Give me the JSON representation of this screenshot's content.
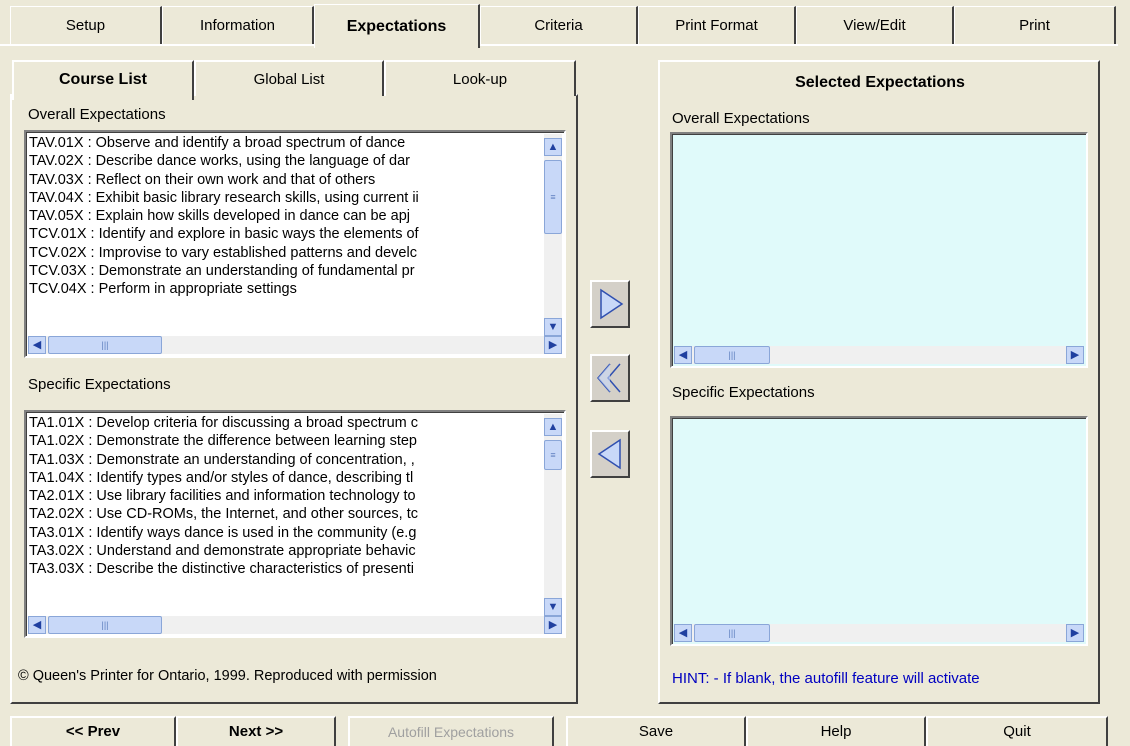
{
  "top_tabs": [
    "Setup",
    "Information",
    "Expectations",
    "Criteria",
    "Print Format",
    "View/Edit",
    "Print"
  ],
  "active_top_tab": "Expectations",
  "left_panel": {
    "tabs": [
      "Course List",
      "Global List",
      "Look-up"
    ],
    "active_tab": "Course List",
    "overall_label": "Overall Expectations",
    "overall_items": [
      "TAV.01X : Observe and identify a broad spectrum of dance",
      "TAV.02X : Describe dance works, using the language of dar",
      "TAV.03X : Reflect on their own work and that of others",
      "TAV.04X : Exhibit basic library research skills, using current ii",
      "TAV.05X : Explain how skills developed in dance can be apj",
      "TCV.01X : Identify and explore in basic ways the elements of",
      "TCV.02X : Improvise to vary established patterns and develc",
      "TCV.03X : Demonstrate an understanding of fundamental pr",
      "TCV.04X : Perform in appropriate settings"
    ],
    "specific_label": "Specific Expectations",
    "specific_items": [
      "TA1.01X : Develop criteria for discussing a broad spectrum c",
      "TA1.02X : Demonstrate the difference between learning step",
      "TA1.03X : Demonstrate an understanding of concentration, ,",
      "TA1.04X : Identify types and/or styles of dance, describing tl",
      "TA2.01X : Use library facilities and information technology to",
      "TA2.02X : Use CD-ROMs, the Internet, and other sources, tc",
      "TA3.01X : Identify ways dance is used in the community (e.g",
      "TA3.02X : Understand and demonstrate appropriate behavic",
      "TA3.03X : Describe the distinctive characteristics of presenti"
    ],
    "copyright": "© Queen's Printer for Ontario, 1999. Reproduced with permission"
  },
  "right_panel": {
    "title": "Selected Expectations",
    "overall_label": "Overall Expectations",
    "specific_label": "Specific Expectations",
    "hint": "HINT: - If blank, the autofill feature will activate"
  },
  "transfer_buttons": [
    "add-arrow-icon",
    "remove-all-arrow-icon",
    "remove-arrow-icon"
  ],
  "bottom_buttons": {
    "prev": "<< Prev",
    "next": "Next >>",
    "autofill": "Autofill Expectations",
    "save": "Save",
    "help": "Help",
    "quit": "Quit"
  },
  "colors": {
    "background": "#ece9d8",
    "selected_list_bg": "#e0fafa",
    "hint_text": "#0000c0",
    "scroll_blue": "#c8d8f8"
  }
}
